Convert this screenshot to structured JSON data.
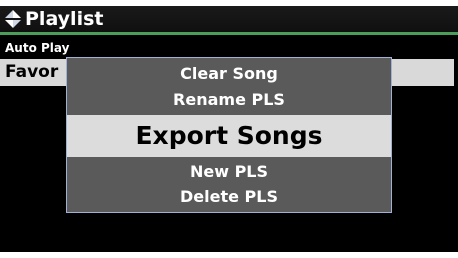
{
  "header": {
    "title": "Playlist",
    "icon": "playlist-icon"
  },
  "list": {
    "items": [
      {
        "label": "Auto Play"
      },
      {
        "label": "Favor",
        "selected": true
      }
    ]
  },
  "popup_menu": {
    "items": [
      {
        "label": "Clear Song"
      },
      {
        "label": "Rename PLS"
      },
      {
        "label": "Export Songs",
        "selected": true
      },
      {
        "label": "New PLS"
      },
      {
        "label": "Delete PLS"
      }
    ]
  },
  "colors": {
    "background": "#000000",
    "accent_line": "#4a9e5a",
    "popup_bg": "#5a5a5a",
    "popup_border": "#9fb2d6",
    "highlight": "#dcdcdc"
  }
}
